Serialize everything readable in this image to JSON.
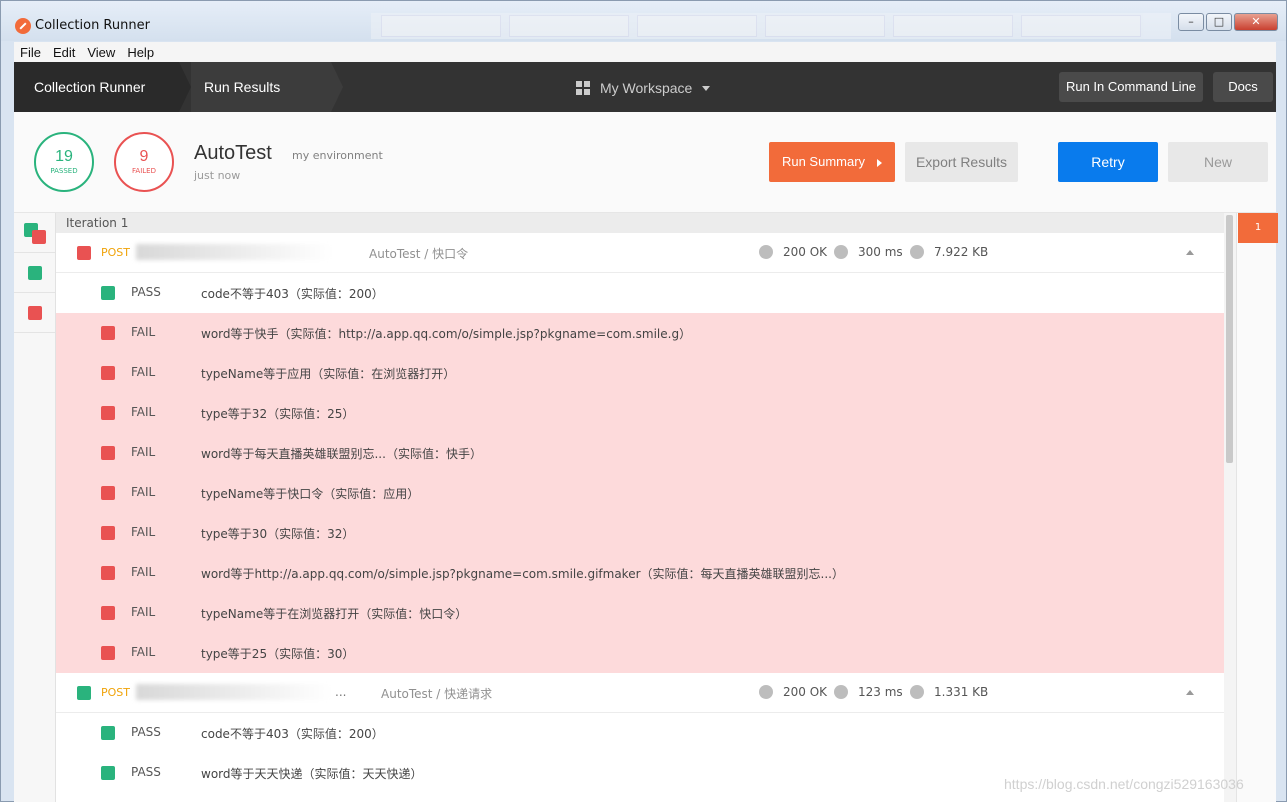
{
  "window": {
    "title": "Collection Runner"
  },
  "menu": [
    "File",
    "Edit",
    "View",
    "Help"
  ],
  "header": {
    "crumb1": "Collection Runner",
    "crumb2": "Run Results",
    "workspace": "My Workspace",
    "cmd_button": "Run In Command Line",
    "docs_button": "Docs"
  },
  "summary": {
    "passed_count": "19",
    "passed_label": "PASSED",
    "failed_count": "9",
    "failed_label": "FAILED",
    "run_name": "AutoTest",
    "environment": "my environment",
    "time": "just now",
    "run_summary_label": "Run Summary",
    "export_label": "Export Results",
    "retry_label": "Retry",
    "new_label": "New"
  },
  "iteration": {
    "label": "Iteration 1",
    "badge": "1"
  },
  "requests": [
    {
      "method": "POST",
      "path": "AutoTest / 快口令",
      "status": "200 OK",
      "time": "300 ms",
      "size": "7.922 KB",
      "tests": [
        {
          "result": "PASS",
          "name": "code不等于403（实际值：200）"
        },
        {
          "result": "FAIL",
          "name": "word等于快手（实际值：http://a.app.qq.com/o/simple.jsp?pkgname=com.smile.g）"
        },
        {
          "result": "FAIL",
          "name": "typeName等于应用（实际值：在浏览器打开）"
        },
        {
          "result": "FAIL",
          "name": "type等于32（实际值：25）"
        },
        {
          "result": "FAIL",
          "name": "word等于每天直播英雄联盟别忘...（实际值：快手）"
        },
        {
          "result": "FAIL",
          "name": "typeName等于快口令（实际值：应用）"
        },
        {
          "result": "FAIL",
          "name": "type等于30（实际值：32）"
        },
        {
          "result": "FAIL",
          "name": "word等于http://a.app.qq.com/o/simple.jsp?pkgname=com.smile.gifmaker（实际值：每天直播英雄联盟别忘...）"
        },
        {
          "result": "FAIL",
          "name": "typeName等于在浏览器打开（实际值：快口令）"
        },
        {
          "result": "FAIL",
          "name": "type等于25（实际值：30）"
        }
      ]
    },
    {
      "method": "POST",
      "url_suffix": "...",
      "path": "AutoTest / 快递请求",
      "status": "200 OK",
      "time": "123 ms",
      "size": "1.331 KB",
      "tests": [
        {
          "result": "PASS",
          "name": "code不等于403（实际值：200）"
        },
        {
          "result": "PASS",
          "name": "word等于天天快递（实际值：天天快递）"
        }
      ]
    }
  ],
  "watermark": "https://blog.csdn.net/congzi529163036",
  "colors": {
    "pass": "#2ab37d",
    "fail": "#e95252",
    "accent": "#f26b3a",
    "retry": "#097bed",
    "fail_row_bg": "#fddadb"
  }
}
